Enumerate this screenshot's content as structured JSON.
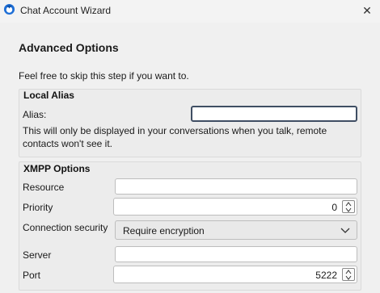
{
  "window": {
    "title": "Chat Account Wizard",
    "close_label": "✕",
    "icon": "thunderbird-app-icon"
  },
  "page": {
    "title": "Advanced Options",
    "description": "Feel free to skip this step if you want to."
  },
  "local_alias": {
    "group_title": "Local Alias",
    "alias_label": "Alias:",
    "alias_value": "",
    "note_line1": "This will only be displayed in your conversations when you talk, remote",
    "note_line2": "contacts won't see it."
  },
  "xmpp": {
    "group_title": "XMPP Options",
    "resource_label": "Resource",
    "resource_value": "",
    "priority_label": "Priority",
    "priority_value": "0",
    "connection_security_label": "Connection security",
    "connection_security_value": "Require encryption",
    "server_label": "Server",
    "server_value": "",
    "port_label": "Port",
    "port_value": "5222"
  },
  "colors": {
    "background": "#f0f0f0",
    "focus_border": "#3f4e63",
    "app_icon_blue": "#1f6fd6"
  }
}
